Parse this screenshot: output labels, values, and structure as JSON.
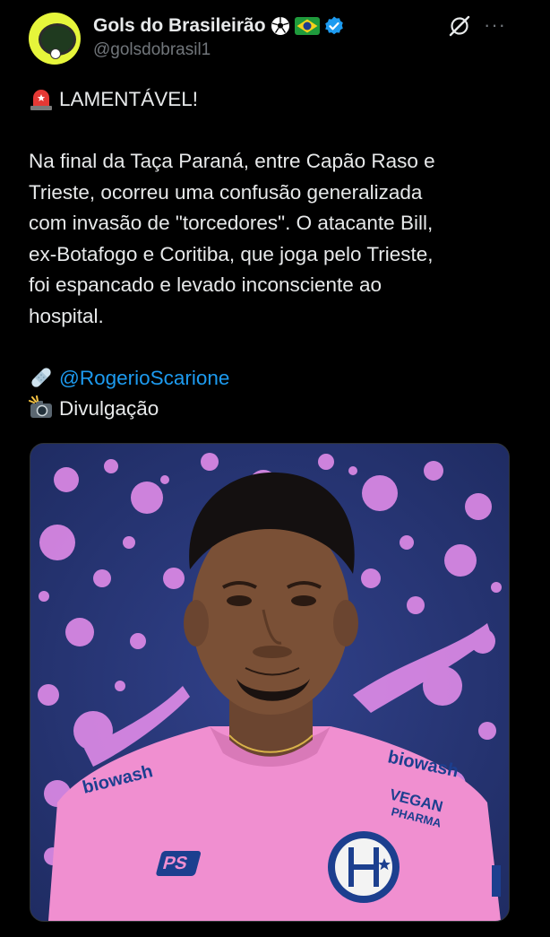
{
  "author": {
    "display_name": "Gols do Brasileirão",
    "handle": "@golsdobrasil1",
    "avatar_icon": "football-club-logo-icon",
    "badges": [
      "soccer-ball-icon",
      "brazil-flag-icon",
      "verified-badge-icon"
    ]
  },
  "header_actions": {
    "grok_icon": "grok-icon",
    "more_label": "···"
  },
  "tweet": {
    "headline_emoji": "siren-icon",
    "headline": "LAMENTÁVEL!",
    "body_lines": [
      "Na final da Taça Paraná, entre Capão Raso e",
      "Trieste, ocorreu uma confusão generalizada",
      "com invasão de \"torcedores\". O atacante Bill,",
      "ex-Botafogo e Coritiba, que joga pelo Trieste,",
      "foi espancado e levado inconsciente ao",
      "hospital."
    ],
    "credit_emoji": "bandage-icon",
    "credit_mention": "@RogerioScarione",
    "photo_emoji": "camera-flash-icon",
    "photo_credit": "Divulgação"
  },
  "media": {
    "description_icon": "player-photo",
    "shirt_texts": [
      "biowash",
      "biowash",
      "VEGAN",
      "PHARMA",
      "PS"
    ],
    "colors": {
      "background": "#2a3a78",
      "splatter": "#e08be8",
      "shirt": "#f08fd0",
      "accent": "#1c3f8f"
    }
  },
  "colors": {
    "text": "#e7e9ea",
    "secondary": "#71767b",
    "link": "#1d9bf0",
    "avatar": "#e6f53b"
  }
}
